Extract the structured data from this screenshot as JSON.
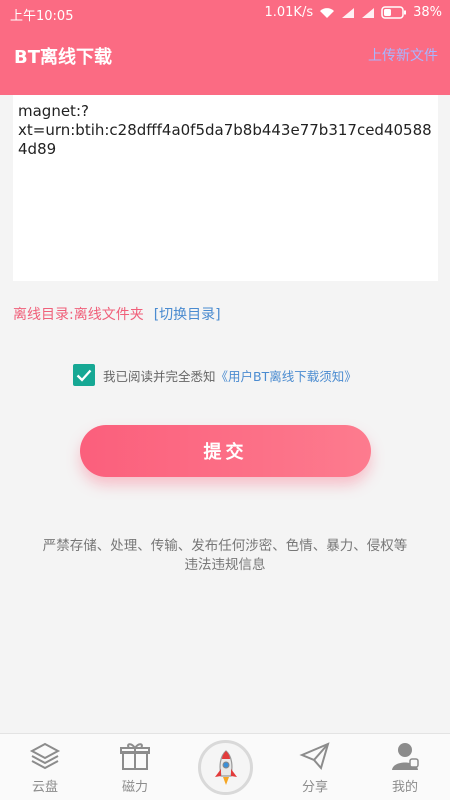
{
  "status_bar": {
    "time": "上午10:05",
    "speed": "1.01K/s",
    "battery": "38%"
  },
  "header": {
    "title": "BT离线下载",
    "action": "上传新文件"
  },
  "magnet_input": {
    "value": "magnet:?\nxt=urn:btih:c28dfff4a0f5da7b8b443e77b317ced405884d89"
  },
  "directory": {
    "label": "离线目录:离线文件夹",
    "switch_label": "[切换目录]"
  },
  "agreement": {
    "checked": true,
    "text": "我已阅读并完全悉知",
    "link": "《用户BT离线下载须知》"
  },
  "submit_label": "提交",
  "warning_text": "严禁存储、处理、传输、发布任何涉密、色情、暴力、侵权等\n违法违规信息",
  "bottom_nav": {
    "items": [
      {
        "label": "云盘",
        "icon": "layers-icon"
      },
      {
        "label": "磁力",
        "icon": "gift-icon"
      },
      {
        "label": "",
        "icon": "rocket-icon"
      },
      {
        "label": "分享",
        "icon": "paper-plane-icon"
      },
      {
        "label": "我的",
        "icon": "user-icon"
      }
    ]
  },
  "colors": {
    "header": "#fb6b83",
    "accent": "#f0607a",
    "link": "#4a8bd0",
    "checkbox": "#16a894"
  }
}
